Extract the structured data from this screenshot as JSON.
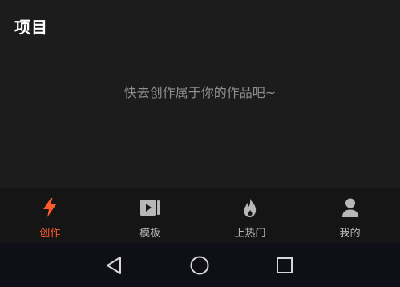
{
  "header": {
    "title": "项目"
  },
  "empty_state": {
    "message": "快去创作属于你的作品吧~"
  },
  "tabs": [
    {
      "label": "创作",
      "icon": "lightning-icon",
      "active": true,
      "color": "#ff5a2b"
    },
    {
      "label": "模板",
      "icon": "video-template-icon",
      "active": false
    },
    {
      "label": "上热门",
      "icon": "flame-icon",
      "active": false
    },
    {
      "label": "我的",
      "icon": "person-icon",
      "active": false
    }
  ],
  "system_nav": {
    "buttons": [
      {
        "icon": "back-triangle-icon"
      },
      {
        "icon": "home-circle-icon"
      },
      {
        "icon": "recents-square-icon"
      }
    ]
  },
  "colors": {
    "background": "#1c1c1c",
    "tab_bar": "#151515",
    "accent": "#ff5a2b",
    "inactive": "#b7b7b7",
    "nav_bar": "#0f0f17"
  }
}
